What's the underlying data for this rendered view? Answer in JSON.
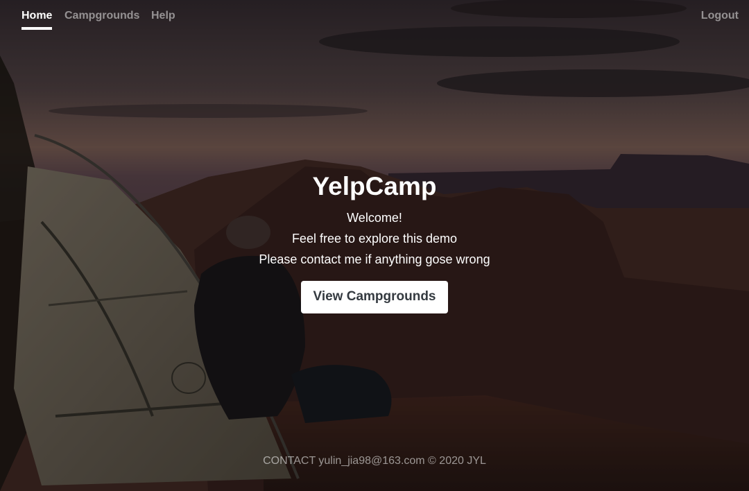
{
  "nav": {
    "home": "Home",
    "campgrounds": "Campgrounds",
    "help": "Help",
    "logout": "Logout"
  },
  "hero": {
    "title": "YelpCamp",
    "lines": [
      "Welcome!",
      "Feel free to explore this demo",
      "Please contact me if anything gose wrong"
    ],
    "cta_label": "View Campgrounds"
  },
  "footer": {
    "text": "CONTACT yulin_jia98@163.com © 2020 JYL"
  },
  "colors": {
    "overlay": "#000000",
    "button_bg": "#ffffff",
    "button_text": "#343a40"
  }
}
